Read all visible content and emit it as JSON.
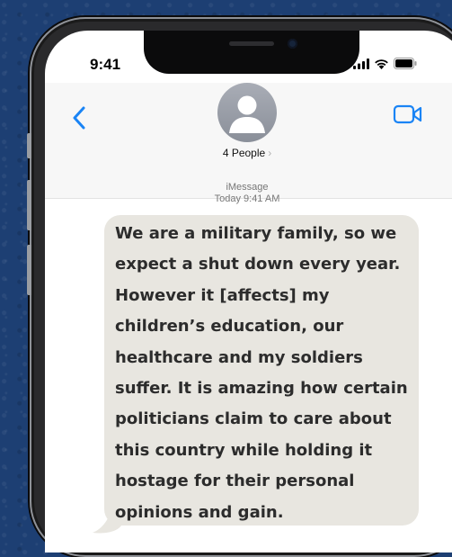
{
  "status_bar": {
    "time": "9:41"
  },
  "header": {
    "contact_name": "4 People",
    "chevron": "›",
    "back_icon": "chevron-left-icon",
    "video_icon": "video-camera-icon",
    "accent_color": "#1a84f5"
  },
  "conversation": {
    "service": "iMessage",
    "timestamp": "Today 9:41 AM",
    "message": "We are a military family, so we expect a shut down every year. However it [affects] my children’s education, our healthcare and my soldiers suffer. It is amazing how certain politicians claim to care about this country while holding it hostage for their personal opinions and gain."
  },
  "colors": {
    "background": "#1d3f73",
    "bubble": "#e8e6e0",
    "bubble_text": "#2c2c2c"
  }
}
